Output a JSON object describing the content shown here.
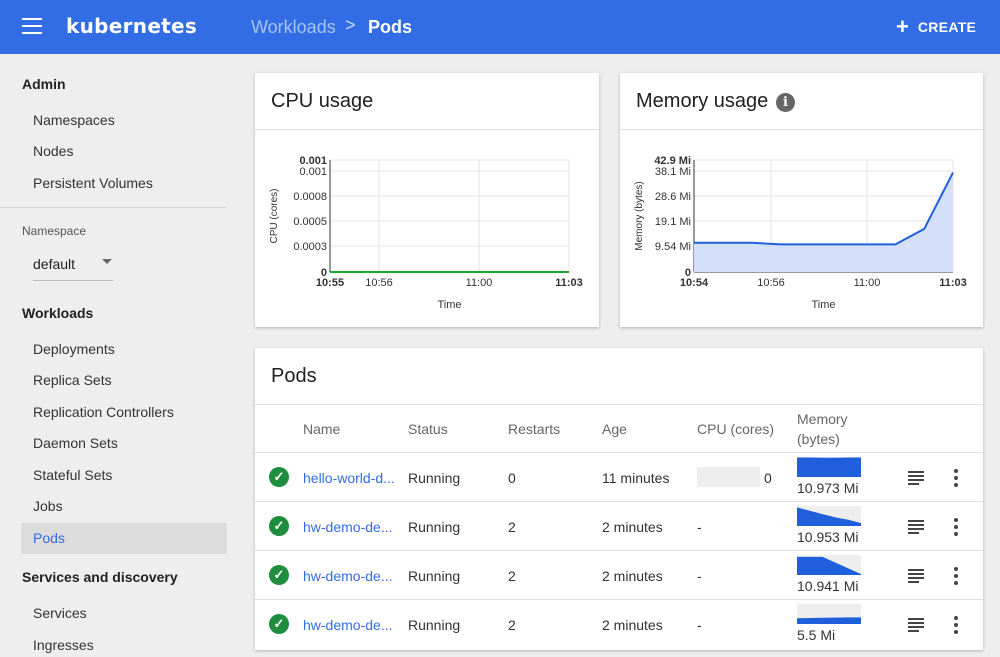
{
  "header": {
    "logo": "kubernetes",
    "breadcrumb_parent": "Workloads",
    "breadcrumb_sep": ">",
    "breadcrumb_current": "Pods",
    "create_icon": "+",
    "create_label": "CREATE"
  },
  "sidebar": {
    "admin_heading": "Admin",
    "admin_items": [
      "Namespaces",
      "Nodes",
      "Persistent Volumes"
    ],
    "namespace_label": "Namespace",
    "namespace_value": "default",
    "workloads_heading": "Workloads",
    "workloads_items": [
      "Deployments",
      "Replica Sets",
      "Replication Controllers",
      "Daemon Sets",
      "Stateful Sets",
      "Jobs",
      "Pods"
    ],
    "active_item": "Pods",
    "services_heading": "Services and discovery",
    "services_items": [
      "Services",
      "Ingresses"
    ]
  },
  "cpu_card": {
    "title": "CPU usage"
  },
  "memory_card": {
    "title": "Memory usage",
    "info_icon": "i"
  },
  "pods_card": {
    "title": "Pods",
    "columns": {
      "name": "Name",
      "status": "Status",
      "restarts": "Restarts",
      "age": "Age",
      "cpu": "CPU (cores)",
      "memory_1": "Memory",
      "memory_2": "(bytes)"
    },
    "rows": [
      {
        "name": "hello-world-d...",
        "status": "Running",
        "restarts": "0",
        "age": "11 minutes",
        "cpu": "0",
        "memory": "10.973 Mi"
      },
      {
        "name": "hw-demo-de...",
        "status": "Running",
        "restarts": "2",
        "age": "2 minutes",
        "cpu": "-",
        "memory": "10.953 Mi"
      },
      {
        "name": "hw-demo-de...",
        "status": "Running",
        "restarts": "2",
        "age": "2 minutes",
        "cpu": "-",
        "memory": "10.941 Mi"
      },
      {
        "name": "hw-demo-de...",
        "status": "Running",
        "restarts": "2",
        "age": "2 minutes",
        "cpu": "-",
        "memory": "5.5 Mi"
      }
    ],
    "status_icon": "check-circle",
    "check_glyph": "✓"
  },
  "colors": {
    "brand": "#326de6",
    "success": "#1e8e3e",
    "cpu_line": "#1aaa2a",
    "memory_line": "#1f5fdc",
    "memory_fill": "#d4e0f9"
  },
  "chart_data": [
    {
      "type": "line",
      "title": "CPU usage",
      "xlabel": "Time",
      "ylabel": "CPU (cores)",
      "x_ticks": [
        "10:55",
        "10:56",
        "11:00",
        "11:03"
      ],
      "y_ticks": [
        "0",
        "0.0003",
        "0.0005",
        "0.0008",
        "0.001",
        "0.001"
      ],
      "ylim": [
        0,
        0.001
      ],
      "grid": true,
      "series": [
        {
          "x": [
            "10:55",
            "10:56",
            "11:00",
            "11:03"
          ],
          "values": [
            0,
            0,
            0,
            0
          ]
        }
      ]
    },
    {
      "type": "area",
      "title": "Memory usage",
      "xlabel": "Time",
      "ylabel": "Memory (bytes)",
      "x_ticks": [
        "10:54",
        "10:56",
        "11:00",
        "11:03"
      ],
      "y_ticks": [
        "0",
        "9.54 Mi",
        "19.1 Mi",
        "28.6 Mi",
        "38.1 Mi",
        "42.9 Mi"
      ],
      "ylim": [
        0,
        42.9
      ],
      "grid": true,
      "series": [
        {
          "x": [
            "10:54",
            "10:55",
            "10:56",
            "10:57",
            "10:58",
            "10:59",
            "11:00",
            "11:01",
            "11:02",
            "11:03"
          ],
          "values": [
            11.2,
            11.2,
            11.2,
            10.6,
            10.6,
            10.6,
            10.6,
            10.6,
            16.5,
            38.1
          ]
        }
      ]
    }
  ],
  "sparklines": [
    [
      20.5,
      20.5,
      20.2,
      20.2,
      20.5,
      20.5
    ],
    [
      19.5,
      16,
      12.5,
      9,
      6.5,
      3
    ],
    [
      19,
      19,
      19,
      13,
      7,
      1
    ],
    [
      6,
      6.3,
      6.5,
      6.7,
      6.9,
      7
    ]
  ]
}
